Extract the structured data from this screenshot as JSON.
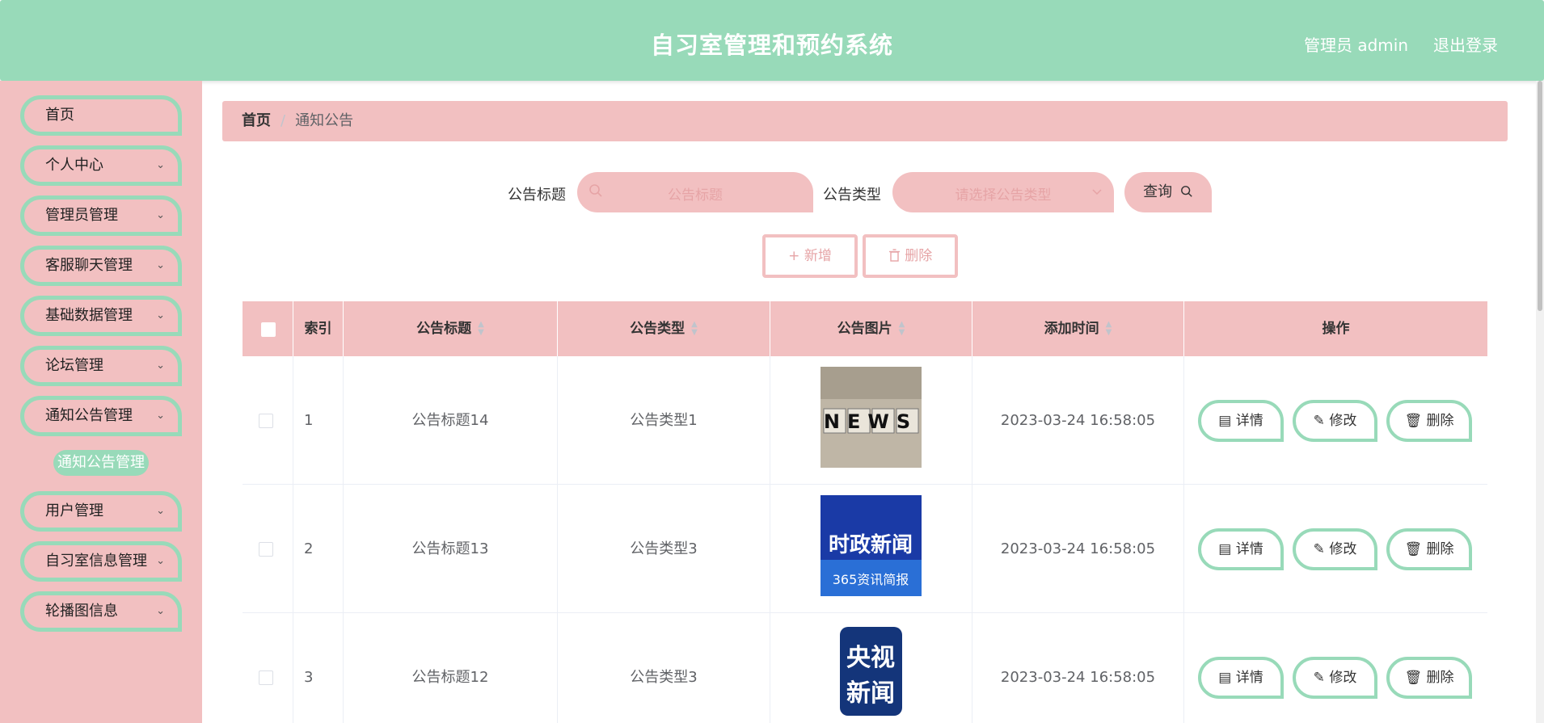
{
  "header": {
    "title": "自习室管理和预约系统",
    "user": "管理员 admin",
    "logout": "退出登录"
  },
  "sidebar": {
    "items": [
      {
        "label": "首页"
      },
      {
        "label": "个人中心"
      },
      {
        "label": "管理员管理"
      },
      {
        "label": "客服聊天管理"
      },
      {
        "label": "基础数据管理"
      },
      {
        "label": "论坛管理"
      },
      {
        "label": "通知公告管理"
      },
      {
        "label": "用户管理"
      },
      {
        "label": "自习室信息管理"
      },
      {
        "label": "轮播图信息"
      }
    ],
    "active_sub": "通知公告管理"
  },
  "breadcrumb": {
    "home": "首页",
    "separator": "/",
    "current": "通知公告"
  },
  "search": {
    "title_label": "公告标题",
    "title_placeholder": "公告标题",
    "type_label": "公告类型",
    "type_placeholder": "请选择公告类型",
    "query_label": "查询"
  },
  "actions": {
    "add_label": "新增",
    "delete_label": "删除"
  },
  "table": {
    "headers": {
      "index": "索引",
      "title": "公告标题",
      "type": "公告类型",
      "image": "公告图片",
      "time": "添加时间",
      "ops": "操作"
    },
    "rows": [
      {
        "index": "1",
        "title": "公告标题14",
        "type": "公告类型1",
        "image_text": "NEWS",
        "time": "2023-03-24 16:58:05"
      },
      {
        "index": "2",
        "title": "公告标题13",
        "type": "公告类型3",
        "image_text": "时政新闻",
        "image_sub": "365资讯简报",
        "time": "2023-03-24 16:58:05"
      },
      {
        "index": "3",
        "title": "公告标题12",
        "type": "公告类型3",
        "image_text": "央视",
        "image_text2": "新闻",
        "time": "2023-03-24 16:58:05"
      }
    ],
    "op_labels": {
      "detail": "详情",
      "edit": "修改",
      "delete": "删除"
    }
  },
  "colors": {
    "primary_green": "#98dab9",
    "primary_pink": "#f2c0c1"
  }
}
